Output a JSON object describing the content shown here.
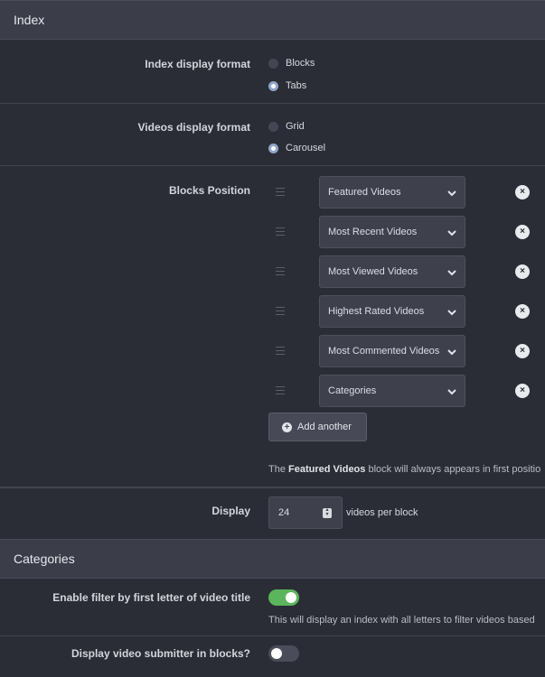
{
  "index_section": {
    "title": "Index"
  },
  "index_display": {
    "label": "Index display format",
    "options": [
      {
        "label": "Blocks",
        "checked": false
      },
      {
        "label": "Tabs",
        "checked": true
      }
    ]
  },
  "videos_display": {
    "label": "Videos display format",
    "options": [
      {
        "label": "Grid",
        "checked": false
      },
      {
        "label": "Carousel",
        "checked": true
      }
    ]
  },
  "blocks": {
    "label": "Blocks Position",
    "items": [
      "Featured Videos",
      "Most Recent Videos",
      "Most Viewed Videos",
      "Highest Rated Videos",
      "Most Commented Videos",
      "Categories"
    ],
    "add_label": "Add another",
    "note_prefix": "The ",
    "note_bold": "Featured Videos",
    "note_suffix": " block will always appears in first positio"
  },
  "display": {
    "label": "Display",
    "value": "24",
    "suffix": "videos per block"
  },
  "categories_section": {
    "title": "Categories"
  },
  "filter_letter": {
    "label": "Enable filter by first letter of video title",
    "enabled": true,
    "help": "This will display an index with all letters to filter videos based"
  },
  "submitter": {
    "label": "Display video submitter in blocks?",
    "enabled": false
  },
  "colors": {
    "background": "#2b2d36",
    "header": "#3b3e49",
    "toggle_on": "#5bb55c",
    "radio_checked": "#8fa7c9"
  }
}
